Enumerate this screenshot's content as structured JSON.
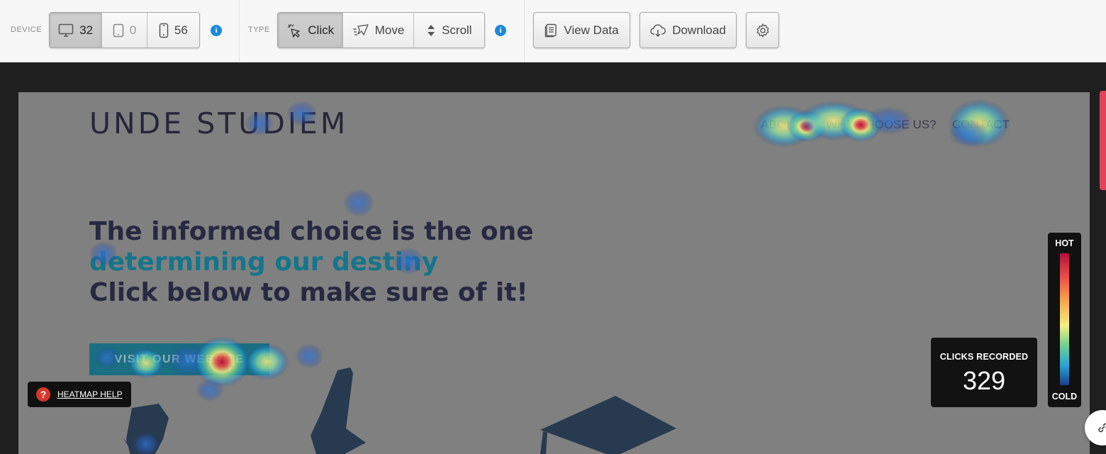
{
  "toolbar": {
    "device_label": "DEVICE",
    "devices": [
      {
        "name": "desktop",
        "icon": "desktop-icon",
        "count": "32",
        "active": true
      },
      {
        "name": "tablet",
        "icon": "tablet-icon",
        "count": "0",
        "active": false
      },
      {
        "name": "mobile",
        "icon": "mobile-icon",
        "count": "56",
        "active": false
      }
    ],
    "type_label": "TYPE",
    "types": [
      {
        "name": "click",
        "icon": "click-icon",
        "label": "Click",
        "active": true
      },
      {
        "name": "move",
        "icon": "move-icon",
        "label": "Move",
        "active": false
      },
      {
        "name": "scroll",
        "icon": "scroll-icon",
        "label": "Scroll",
        "active": false
      }
    ],
    "view_data_label": "View Data",
    "download_label": "Download",
    "settings_icon": "gear-icon",
    "info_glyph": "i"
  },
  "site": {
    "logo": "UNDE STUDIEM",
    "nav": [
      "ABOUT",
      "WHY CHOOSE US?",
      "CONTACT"
    ],
    "headline_line1": "The informed choice is the one",
    "headline_line2": "determining our destiny",
    "headline_line3": "Click below to make sure of it!",
    "cta": "VISIT OUR WEBSITE"
  },
  "overlay": {
    "help_label": "HEATMAP HELP",
    "help_glyph": "?",
    "clicks_label": "CLICKS RECORDED",
    "clicks_count": "329",
    "legend_hot": "HOT",
    "legend_cold": "COLD"
  },
  "colors": {
    "accent_blue": "#1a8ad8",
    "heat_hot": "#b3103c",
    "heat_cold": "#1a3e8c",
    "teal_text": "#16758a",
    "help_red": "#d8362b",
    "scroll_indicator": "#e6415a"
  }
}
